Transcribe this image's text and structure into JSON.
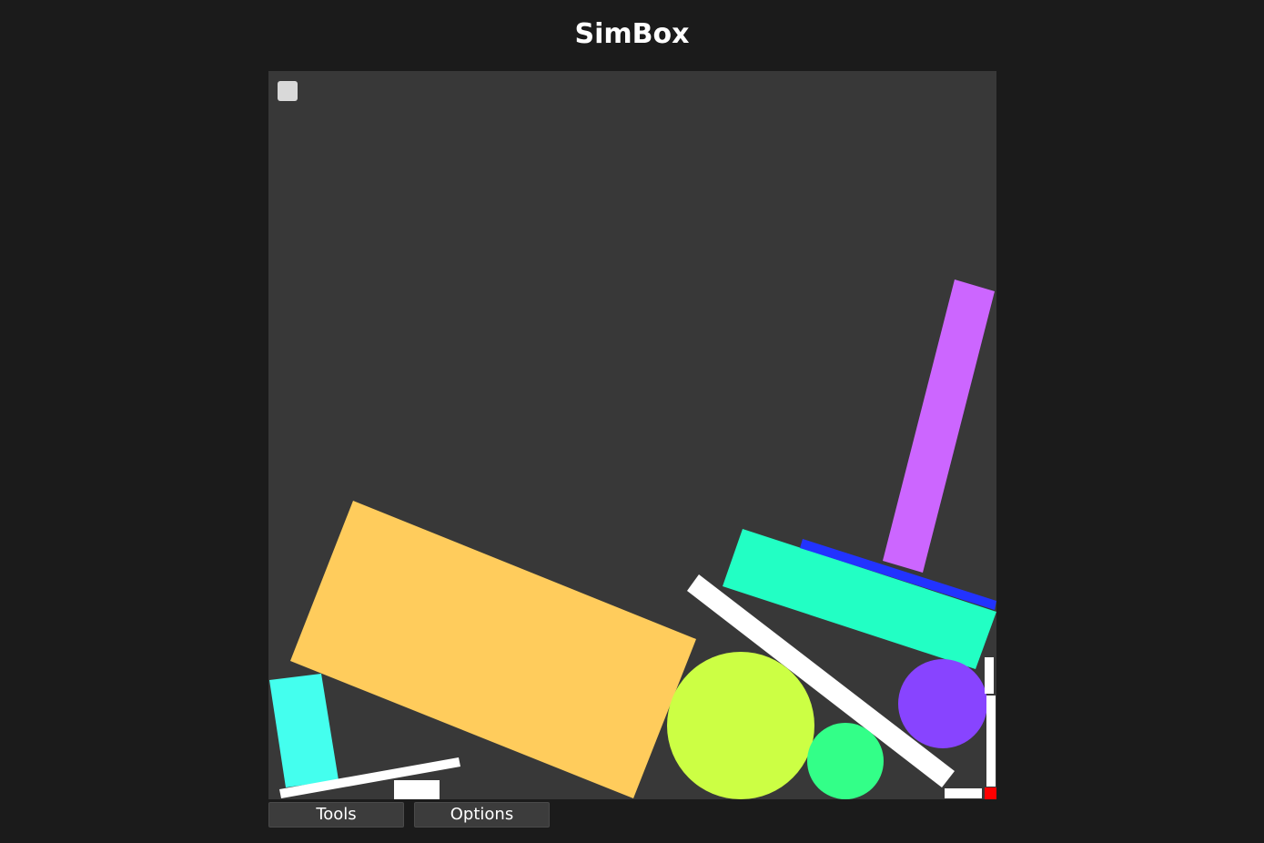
{
  "header": {
    "title": "SimBox"
  },
  "toolbar": {
    "tools_label": "Tools",
    "options_label": "Options"
  },
  "canvas": {
    "background": "#383838",
    "pause_toggle_color": "#d9d9d9"
  },
  "palette": {
    "page_background": "#1b1b1b",
    "orange_box": "#ffcc5c",
    "cyan_block": "#44ffee",
    "lime_ball": "#ccff44",
    "green_ball": "#33ff88",
    "purple_ball": "#8844ff",
    "teal_slab": "#22ffc4",
    "blue_bar": "#2233ff",
    "violet_pillar": "#cc66ff",
    "static_white": "#ffffff",
    "marker_red": "#ff0000"
  }
}
